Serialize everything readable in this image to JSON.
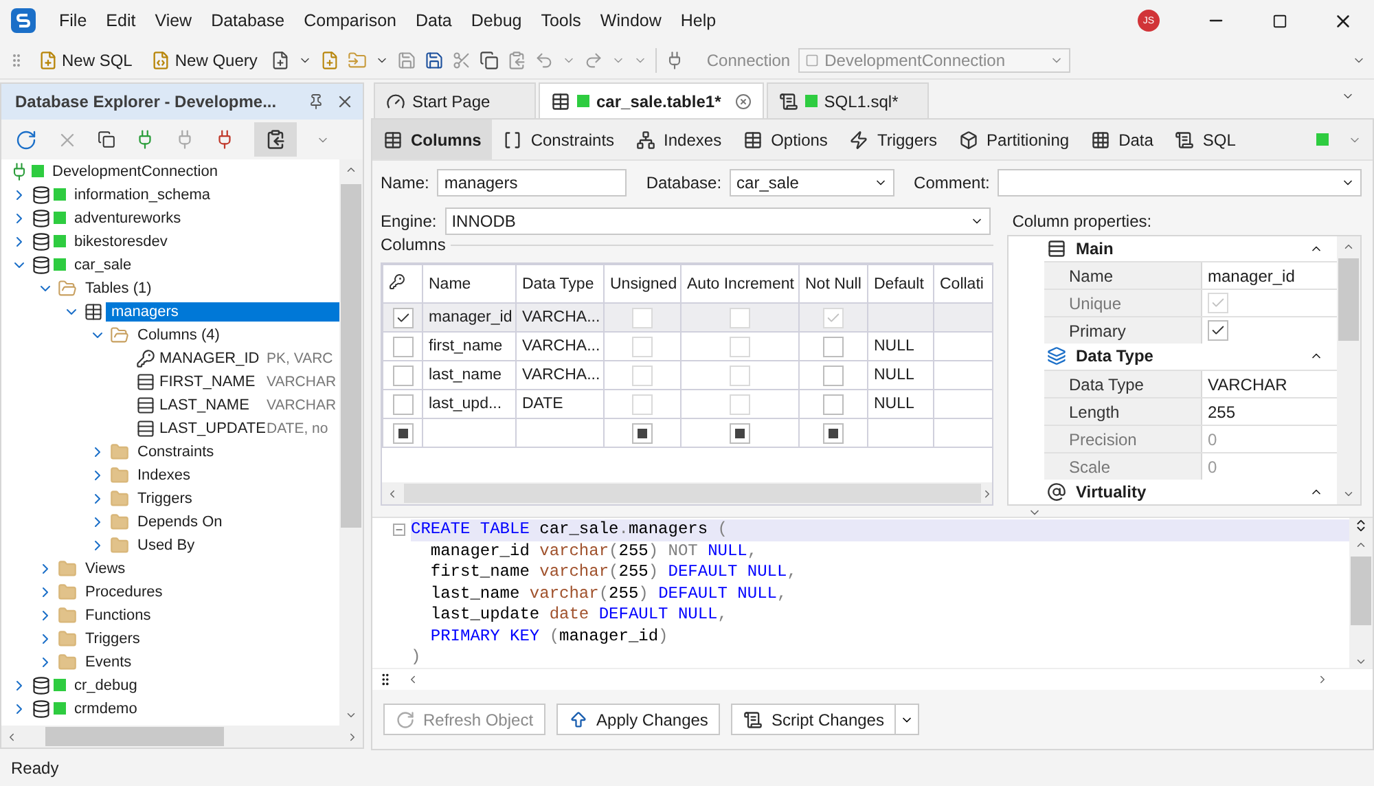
{
  "app": {
    "menu": [
      "File",
      "Edit",
      "View",
      "Database",
      "Comparison",
      "Data",
      "Debug",
      "Tools",
      "Window",
      "Help"
    ],
    "user_initials": "JS"
  },
  "toolbar": {
    "buttons": [
      {
        "label": "New SQL",
        "kind": "sql"
      },
      {
        "label": "New Query",
        "kind": "query"
      }
    ],
    "connection_label": "Connection",
    "connection": "DevelopmentConnection"
  },
  "explorer": {
    "title": "Database Explorer - Developme...",
    "root": {
      "label": "DevelopmentConnection",
      "kind": "connection",
      "selected": false,
      "children": [
        {
          "label": "information_schema",
          "kind": "database",
          "expanded": false,
          "selected": false
        },
        {
          "label": "adventureworks",
          "kind": "database",
          "expanded": false,
          "selected": false
        },
        {
          "label": "bikestoresdev",
          "kind": "database",
          "expanded": false,
          "selected": false
        },
        {
          "label": "car_sale",
          "kind": "database",
          "expanded": true,
          "selected": false,
          "children": [
            {
              "label": "Tables (1)",
              "kind": "folder",
              "expanded": true,
              "selected": false,
              "children": [
                {
                  "label": "managers",
                  "kind": "table",
                  "expanded": true,
                  "selected": true,
                  "children": [
                    {
                      "label": "Columns (4)",
                      "kind": "folder",
                      "expanded": true,
                      "selected": false,
                      "children": [
                        {
                          "label": "MANAGER_ID",
                          "detail": "PK, VARC",
                          "kind": "key-column",
                          "selected": false
                        },
                        {
                          "label": "FIRST_NAME",
                          "detail": "VARCHAR",
                          "kind": "column",
                          "selected": false
                        },
                        {
                          "label": "LAST_NAME",
                          "detail": "VARCHAR",
                          "kind": "column",
                          "selected": false
                        },
                        {
                          "label": "LAST_UPDATE",
                          "detail": "DATE, no",
                          "kind": "column",
                          "selected": false
                        }
                      ]
                    },
                    {
                      "label": "Constraints",
                      "kind": "folder",
                      "expanded": false,
                      "selected": false
                    },
                    {
                      "label": "Indexes",
                      "kind": "folder",
                      "expanded": false,
                      "selected": false
                    },
                    {
                      "label": "Triggers",
                      "kind": "folder",
                      "expanded": false,
                      "selected": false
                    },
                    {
                      "label": "Depends On",
                      "kind": "folder",
                      "expanded": false,
                      "selected": false
                    },
                    {
                      "label": "Used By",
                      "kind": "folder",
                      "expanded": false,
                      "selected": false
                    }
                  ]
                }
              ]
            },
            {
              "label": "Views",
              "kind": "folder",
              "expanded": false,
              "selected": false
            },
            {
              "label": "Procedures",
              "kind": "folder",
              "expanded": false,
              "selected": false
            },
            {
              "label": "Functions",
              "kind": "folder",
              "expanded": false,
              "selected": false
            },
            {
              "label": "Triggers",
              "kind": "folder",
              "expanded": false,
              "selected": false
            },
            {
              "label": "Events",
              "kind": "folder",
              "expanded": false,
              "selected": false
            }
          ]
        },
        {
          "label": "cr_debug",
          "kind": "database",
          "expanded": false,
          "selected": false
        },
        {
          "label": "crmdemo",
          "kind": "database",
          "expanded": false,
          "selected": false
        }
      ]
    }
  },
  "document_tabs": [
    {
      "label": "Start Page",
      "kind": "start",
      "selected": false
    },
    {
      "label": "car_sale.table1*",
      "kind": "table",
      "selected": true
    },
    {
      "label": "SQL1.sql*",
      "kind": "sql",
      "selected": false
    }
  ],
  "editor_tabs": [
    {
      "label": "Columns",
      "kind": "columns",
      "selected": true
    },
    {
      "label": "Constraints",
      "kind": "constraints",
      "selected": false
    },
    {
      "label": "Indexes",
      "kind": "indexes",
      "selected": false
    },
    {
      "label": "Options",
      "kind": "options",
      "selected": false
    },
    {
      "label": "Triggers",
      "kind": "triggers",
      "selected": false
    },
    {
      "label": "Partitioning",
      "kind": "partitioning",
      "selected": false
    },
    {
      "label": "Data",
      "kind": "data",
      "selected": false
    },
    {
      "label": "SQL",
      "kind": "sql",
      "selected": false
    }
  ],
  "form": {
    "name_label": "Name:",
    "name": "managers",
    "database_label": "Database:",
    "database": "car_sale",
    "comment_label": "Comment:",
    "engine_label": "Engine:",
    "engine": "INNODB",
    "columns_label": "Columns",
    "properties_label": "Column properties:"
  },
  "grid": {
    "headers": [
      "Name",
      "Data Type",
      "Unsigned",
      "Auto Increment",
      "Not Null",
      "Default",
      "Collati"
    ],
    "rows": [
      {
        "kind": "column",
        "selected": true,
        "primary_key": {
          "checked": true,
          "disabled": false
        },
        "name": "manager_id",
        "data_type": "VARCHA...",
        "unsigned": {
          "checked": false,
          "disabled": true
        },
        "auto_increment": {
          "checked": false,
          "disabled": true
        },
        "not_null": {
          "checked": true,
          "disabled": true
        }
      },
      {
        "kind": "column",
        "selected": false,
        "primary_key": {
          "checked": false,
          "disabled": false
        },
        "name": "first_name",
        "data_type": "VARCHA...",
        "unsigned": {
          "checked": false,
          "disabled": true
        },
        "auto_increment": {
          "checked": false,
          "disabled": true
        },
        "not_null": {
          "checked": false,
          "disabled": false
        },
        "default": "NULL"
      },
      {
        "kind": "column",
        "selected": false,
        "primary_key": {
          "checked": false,
          "disabled": false
        },
        "name": "last_name",
        "data_type": "VARCHA...",
        "unsigned": {
          "checked": false,
          "disabled": true
        },
        "auto_increment": {
          "checked": false,
          "disabled": true
        },
        "not_null": {
          "checked": false,
          "disabled": false
        },
        "default": "NULL"
      },
      {
        "kind": "column",
        "selected": false,
        "primary_key": {
          "checked": false,
          "disabled": false
        },
        "name": "last_upd...",
        "data_type": "DATE",
        "unsigned": {
          "checked": false,
          "disabled": true
        },
        "auto_increment": {
          "checked": false,
          "disabled": true
        },
        "not_null": {
          "checked": false,
          "disabled": false
        },
        "default": "NULL"
      },
      {
        "kind": "new",
        "selected": false,
        "primary_key": {
          "indeterminate": true
        },
        "unsigned": {
          "indeterminate": true
        },
        "auto_increment": {
          "indeterminate": true
        },
        "not_null": {
          "indeterminate": true
        }
      }
    ]
  },
  "properties": {
    "groups": [
      {
        "title": "Main",
        "kind": "main",
        "expanded": true,
        "rows": [
          {
            "label": "Name",
            "kind": "text",
            "value": "manager_id",
            "disabled": false
          },
          {
            "label": "Unique",
            "kind": "check",
            "checked": true,
            "disabled": true
          },
          {
            "label": "Primary",
            "kind": "check",
            "checked": true,
            "disabled": false
          }
        ]
      },
      {
        "title": "Data Type",
        "kind": "datatype",
        "expanded": true,
        "rows": [
          {
            "label": "Data Type",
            "kind": "text",
            "value": "VARCHAR",
            "disabled": false
          },
          {
            "label": "Length",
            "kind": "text",
            "value": "255",
            "disabled": false
          },
          {
            "label": "Precision",
            "kind": "text",
            "value": "0",
            "disabled": true
          },
          {
            "label": "Scale",
            "kind": "text",
            "value": "0",
            "disabled": true
          }
        ]
      },
      {
        "title": "Virtuality",
        "kind": "virtuality",
        "expanded": true
      }
    ]
  },
  "sql": {
    "lines": [
      [
        {
          "text": "CREATE TABLE ",
          "kind": "keyword"
        },
        {
          "text": "car_sale",
          "kind": "identifier"
        },
        {
          "text": ".",
          "kind": "punctuation"
        },
        {
          "text": "managers ",
          "kind": "identifier"
        },
        {
          "text": "(",
          "kind": "punctuation"
        }
      ],
      [
        {
          "text": "  manager_id ",
          "kind": "identifier"
        },
        {
          "text": "varchar",
          "kind": "type"
        },
        {
          "text": "(",
          "kind": "punctuation"
        },
        {
          "text": "255",
          "kind": "identifier"
        },
        {
          "text": ") ",
          "kind": "punctuation"
        },
        {
          "text": "NOT ",
          "kind": "punctuation"
        },
        {
          "text": "NULL",
          "kind": "keyword"
        },
        {
          "text": ",",
          "kind": "punctuation"
        }
      ],
      [
        {
          "text": "  first_name ",
          "kind": "identifier"
        },
        {
          "text": "varchar",
          "kind": "type"
        },
        {
          "text": "(",
          "kind": "punctuation"
        },
        {
          "text": "255",
          "kind": "identifier"
        },
        {
          "text": ") ",
          "kind": "punctuation"
        },
        {
          "text": "DEFAULT NULL",
          "kind": "keyword"
        },
        {
          "text": ",",
          "kind": "punctuation"
        }
      ],
      [
        {
          "text": "  last_name ",
          "kind": "identifier"
        },
        {
          "text": "varchar",
          "kind": "type"
        },
        {
          "text": "(",
          "kind": "punctuation"
        },
        {
          "text": "255",
          "kind": "identifier"
        },
        {
          "text": ") ",
          "kind": "punctuation"
        },
        {
          "text": "DEFAULT NULL",
          "kind": "keyword"
        },
        {
          "text": ",",
          "kind": "punctuation"
        }
      ],
      [
        {
          "text": "  last_update ",
          "kind": "identifier"
        },
        {
          "text": "date ",
          "kind": "type"
        },
        {
          "text": "DEFAULT NULL",
          "kind": "keyword"
        },
        {
          "text": ",",
          "kind": "punctuation"
        }
      ],
      [
        {
          "text": "  PRIMARY KEY ",
          "kind": "keyword"
        },
        {
          "text": "(",
          "kind": "punctuation"
        },
        {
          "text": "manager_id",
          "kind": "identifier"
        },
        {
          "text": ")",
          "kind": "punctuation"
        }
      ],
      [
        {
          "text": ")",
          "kind": "punctuation"
        }
      ]
    ]
  },
  "actions": [
    {
      "label": "Refresh Object",
      "kind": "refresh",
      "disabled": true
    },
    {
      "label": "Apply Changes",
      "kind": "apply",
      "disabled": false
    },
    {
      "label": "Script Changes",
      "kind": "script",
      "disabled": false
    }
  ],
  "status": "Ready"
}
